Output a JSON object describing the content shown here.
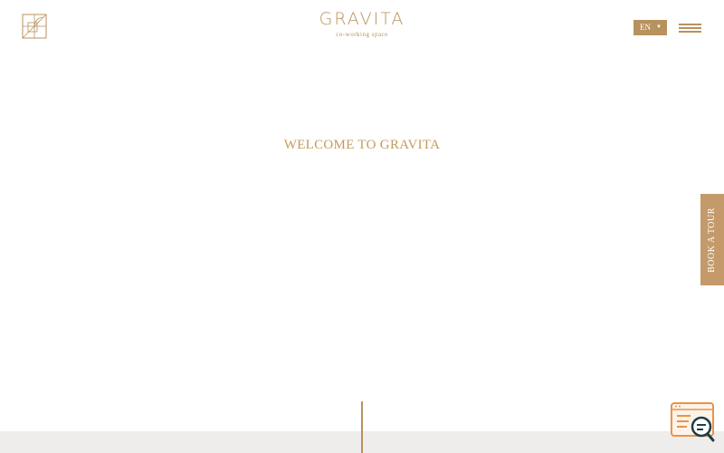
{
  "header": {
    "brand_name": "GRAVITA",
    "brand_tagline": "co-working space",
    "language": "EN"
  },
  "hero": {
    "title": "WELCOME TO GRAVITA"
  },
  "side_tab": {
    "label": "BOOK A TOUR"
  },
  "colors": {
    "accent": "#b8925e",
    "hero_title": "#c49a5e",
    "book_tab": "#c49a6a",
    "chat_orange": "#e8944a",
    "chat_dark": "#1f3d45",
    "bottom_band": "#efedeb"
  },
  "icons": {
    "logo": "monogram-icon",
    "menu": "hamburger-icon",
    "caret": "caret-down-icon",
    "chat": "chat-search-icon"
  }
}
